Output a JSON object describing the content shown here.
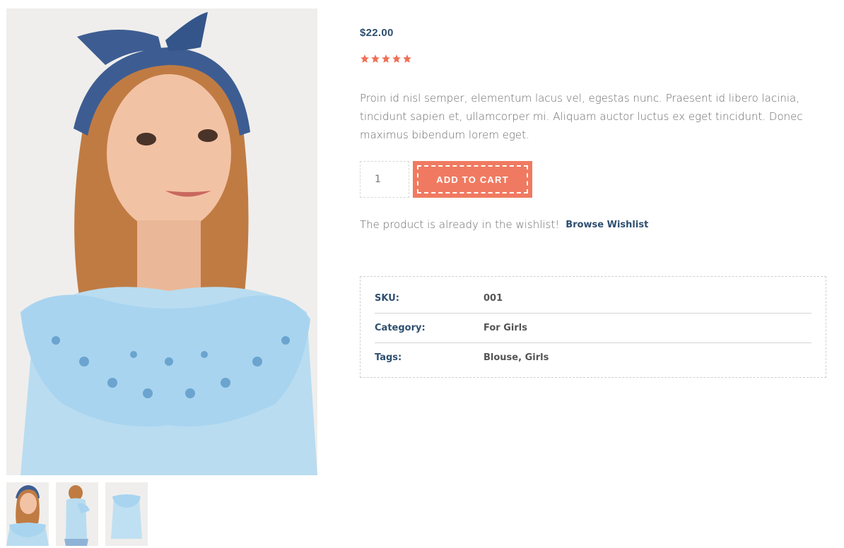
{
  "product": {
    "price": "$22.00",
    "rating": 5,
    "rating_max": 5,
    "description": "Proin id nisl semper, elementum lacus vel, egestas nunc. Praesent id libero lacinia, tincidunt sapien et, ullamcorper mi. Aliquam auctor luctus ex eget tincidunt. Donec maximus bibendum lorem eget.",
    "quantity": "1",
    "add_to_cart_label": "ADD TO CART"
  },
  "wishlist": {
    "message": "The product is already in the wishlist!",
    "link_label": "Browse Wishlist"
  },
  "meta": {
    "sku_label": "SKU:",
    "sku_value": "001",
    "category_label": "Category:",
    "category_value": "For Girls",
    "tags_label": "Tags:",
    "tag_1": "Blouse",
    "tag_separator": ", ",
    "tag_2": "Girls"
  },
  "colors": {
    "accent": "#f07a61",
    "heading": "#2f4f6f",
    "star": "#ef6f57"
  },
  "gallery": {
    "thumbnails": [
      "girl-front",
      "girl-side",
      "blouse-flat"
    ]
  }
}
